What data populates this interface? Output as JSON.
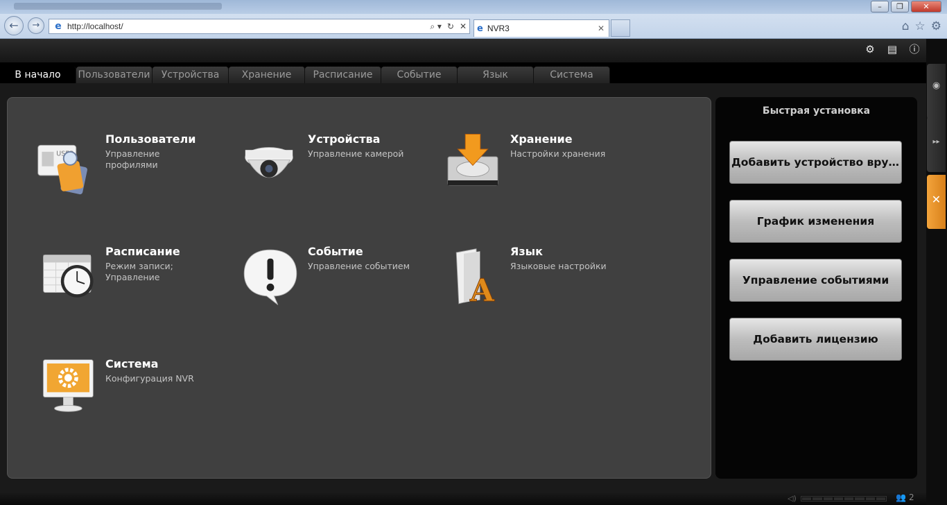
{
  "browser": {
    "window_buttons": [
      "–",
      "❐",
      "✕"
    ],
    "url": "http://localhost/",
    "tab_title": "NVR3",
    "tab_close": "✕",
    "address_controls": [
      "⌕ ▾",
      "↻",
      "✕"
    ],
    "toolbar_icons": [
      "⌂",
      "☆",
      "⚙"
    ]
  },
  "header": {
    "icons": [
      "⚙",
      "▤",
      "ⓘ"
    ]
  },
  "tabs": [
    {
      "label": "В начало",
      "active": true
    },
    {
      "label": "Пользователи",
      "active": false
    },
    {
      "label": "Устройства",
      "active": false
    },
    {
      "label": "Хранение",
      "active": false
    },
    {
      "label": "Расписание",
      "active": false
    },
    {
      "label": "Событие",
      "active": false
    },
    {
      "label": "Язык",
      "active": false
    },
    {
      "label": "Система",
      "active": false
    }
  ],
  "modules": [
    {
      "title": "Пользователи",
      "desc": "Управление профилями",
      "icon": "user-badges-icon"
    },
    {
      "title": "Устройства",
      "desc": "Управление камерой",
      "icon": "dome-camera-icon"
    },
    {
      "title": "Хранение",
      "desc": "Настройки хранения",
      "icon": "hard-drive-icon"
    },
    {
      "title": "Расписание",
      "desc": "Режим записи; Управление",
      "icon": "calendar-clock-icon"
    },
    {
      "title": "Событие",
      "desc": "Управление событием",
      "icon": "alert-bubble-icon"
    },
    {
      "title": "Язык",
      "desc": "Языковые настройки",
      "icon": "language-folder-icon"
    },
    {
      "title": "Система",
      "desc": "Конфигурация NVR",
      "icon": "monitor-gear-icon"
    }
  ],
  "quick_setup": {
    "title": "Быстрая установка",
    "buttons": [
      "Добавить устройство вручную",
      "График изменения",
      "Управление событиями",
      "Добавить лицензию"
    ]
  },
  "side_panel": {
    "buttons": [
      {
        "icon": "eye-icon",
        "glyph": "◉"
      },
      {
        "icon": "fast-forward-icon",
        "glyph": "▸▸"
      },
      {
        "icon": "tools-icon",
        "glyph": "✕"
      }
    ]
  },
  "status_bar": {
    "user_count": "2"
  }
}
